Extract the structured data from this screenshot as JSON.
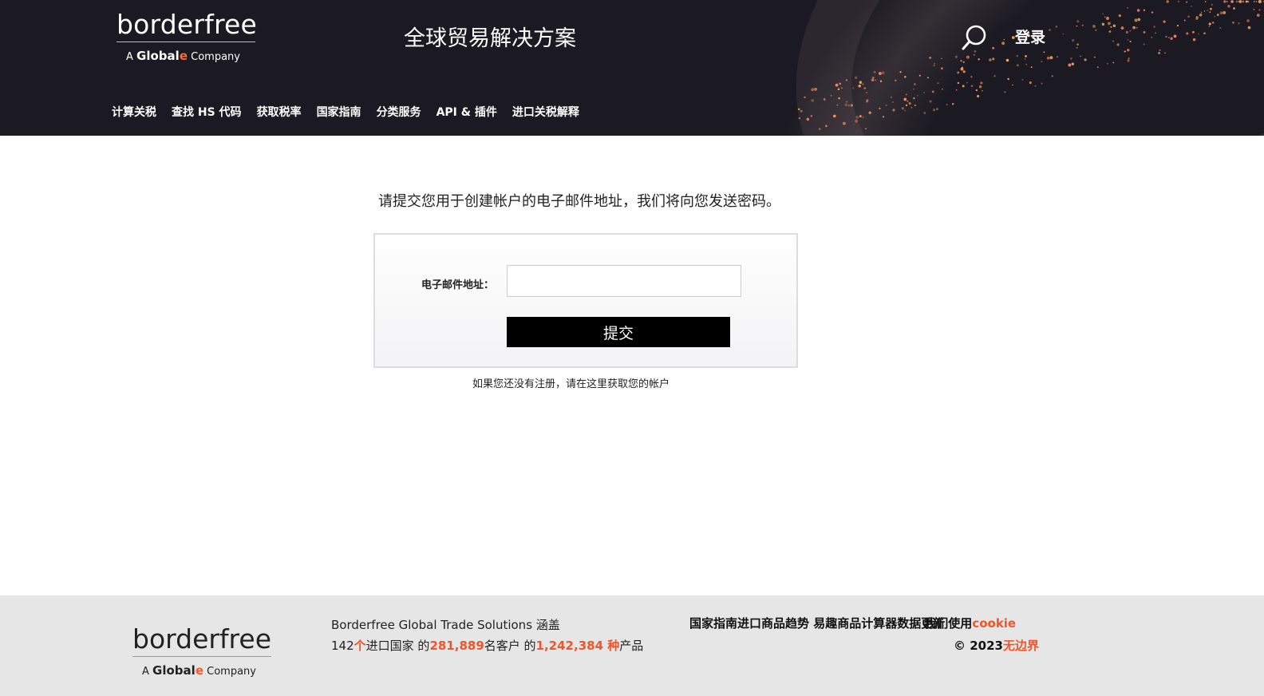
{
  "header": {
    "logo_word": "borderfree",
    "logo_prefix": "A",
    "logo_global": "Global",
    "logo_e": "e",
    "logo_company": "Company",
    "tagline": "全球贸易解决方案",
    "login_label": "登录",
    "nav": [
      {
        "label": "计算关税"
      },
      {
        "label": "查找 HS 代码"
      },
      {
        "label": "获取税率"
      },
      {
        "label": "国家指南"
      },
      {
        "label": "分类服务"
      },
      {
        "label": "API & 插件"
      },
      {
        "label": "进口关税解释"
      }
    ]
  },
  "main": {
    "instructions": "请提交您用于创建帐户的电子邮件地址，我们将向您发送密码。",
    "email_label": "电子邮件地址：",
    "email_value": "",
    "submit_label": "提交",
    "register_note": "如果您还没有注册，请在这里获取您的帐户"
  },
  "footer": {
    "logo_word": "borderfree",
    "logo_prefix": "A",
    "logo_global": "Global",
    "logo_e": "e",
    "logo_company": "Company",
    "stats_line1": "Borderfree Global Trade Solutions 涵盖",
    "stats_countries_num": "142",
    "stats_countries_unit": "个",
    "stats_countries_text": "进口国家 的",
    "stats_customers_num": "281,889",
    "stats_customers_text": "名客户 的",
    "stats_products_num": "1,242,384 种",
    "stats_products_text": "产品",
    "links": {
      "country_guide": "国家指南",
      "import_trends": "进口商品趋势",
      "trade_calc": "易趣商品计算器",
      "data_update": "数据更新",
      "we_use": "我们使用",
      "cookie": "cookie"
    },
    "copyright": "© 2023",
    "copyright_brand": "无边界"
  },
  "colors": {
    "header_bg": "#1b1a22",
    "accent": "#f0552c",
    "footer_bg": "#e6e6e6",
    "button_bg": "#000000"
  }
}
